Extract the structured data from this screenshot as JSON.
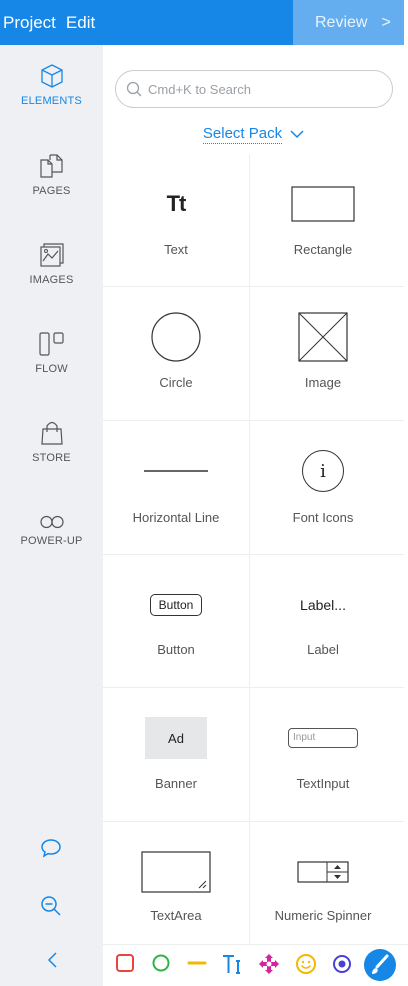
{
  "menu": {
    "project": "Project",
    "edit": "Edit",
    "review": "Review",
    "review_chevron": ">"
  },
  "sidebar": {
    "items": [
      {
        "label": "ELEMENTS",
        "icon": "cube-icon",
        "active": true
      },
      {
        "label": "PAGES",
        "icon": "pages-icon"
      },
      {
        "label": "IMAGES",
        "icon": "images-icon"
      },
      {
        "label": "FLOW",
        "icon": "flow-icon"
      },
      {
        "label": "STORE",
        "icon": "shopping-bag-icon"
      },
      {
        "label": "POWER-UP",
        "icon": "infinity-icon"
      }
    ],
    "bottom_icons": [
      "chat-bubble-icon",
      "zoom-out-icon",
      "collapse-left-icon"
    ]
  },
  "search": {
    "placeholder": "Cmd+K to Search"
  },
  "pack": {
    "label": "Select Pack"
  },
  "elements": [
    {
      "name": "Text",
      "preview": "Tt"
    },
    {
      "name": "Rectangle"
    },
    {
      "name": "Circle"
    },
    {
      "name": "Image"
    },
    {
      "name": "Horizontal Line"
    },
    {
      "name": "Font Icons",
      "preview": "i"
    },
    {
      "name": "Button",
      "preview": "Button"
    },
    {
      "name": "Label",
      "preview": "Label..."
    },
    {
      "name": "Banner",
      "preview": "Ad"
    },
    {
      "name": "TextInput",
      "preview": "Input"
    },
    {
      "name": "TextArea"
    },
    {
      "name": "Numeric Spinner"
    }
  ],
  "toolbar": {
    "tools": [
      "rectangle-tool-icon",
      "circle-tool-icon",
      "line-tool-icon",
      "text-tool-icon",
      "move-tool-icon",
      "emoji-tool-icon",
      "radio-tool-icon",
      "brush-tool-icon"
    ],
    "colors": {
      "red": "#e8453c",
      "green": "#2fb344",
      "yellow": "#f5b800",
      "blue": "#1687e6",
      "magenta": "#d6249f"
    }
  },
  "colors": {
    "accent": "#1687e6",
    "review_bg": "#64aef0",
    "sidebar_bg": "#eef0f3"
  }
}
